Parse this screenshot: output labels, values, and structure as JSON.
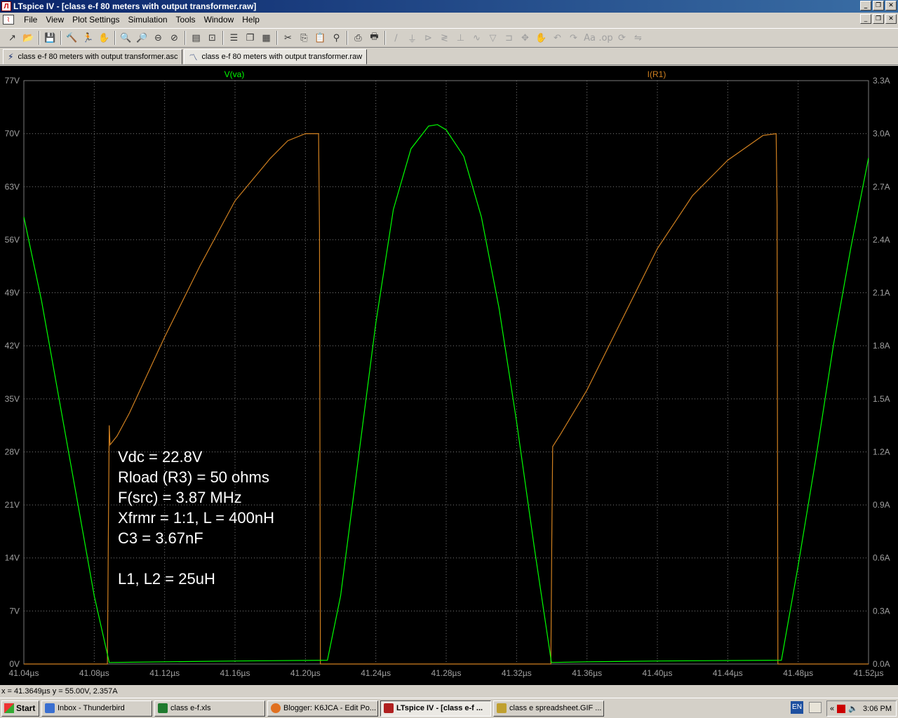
{
  "window": {
    "title": "LTspice IV - [class e-f 80 meters with output transformer.raw]",
    "app_icon": "ltspice-icon",
    "controls": [
      "_",
      "❐",
      "✕"
    ]
  },
  "menu": {
    "items": [
      "File",
      "View",
      "Plot Settings",
      "Simulation",
      "Tools",
      "Window",
      "Help"
    ],
    "mdi_controls": [
      "_",
      "❐",
      "✕"
    ]
  },
  "toolbar": {
    "icons": [
      "new-schematic-icon",
      "open-icon",
      "save-icon",
      "control-panel-icon",
      "run-icon",
      "halt-icon",
      "zoom-in-icon",
      "zoom-area-icon",
      "zoom-out-icon",
      "zoom-cancel-icon",
      "autorange-icon",
      "fit-icon",
      "tile-horizontal-icon",
      "cascade-icon",
      "tile-vertical-icon",
      "cut-icon",
      "copy-icon",
      "paste-icon",
      "find-icon",
      "print-preview-icon",
      "print-icon",
      "wire-icon",
      "ground-icon",
      "label-icon",
      "resistor-icon",
      "capacitor-icon",
      "inductor-icon",
      "diode-icon",
      "component-icon",
      "move-icon",
      "drag-icon",
      "undo-icon",
      "redo-icon",
      "text-icon",
      "spice-directive-icon",
      "rotate-icon",
      "mirror-icon"
    ]
  },
  "tabs": [
    {
      "label": "class e-f 80 meters with output transformer.asc",
      "icon": "schematic-icon"
    },
    {
      "label": "class e-f 80 meters with output transformer.raw",
      "icon": "waveform-icon"
    }
  ],
  "chart_data": {
    "type": "line",
    "traces": [
      {
        "name": "V(va)",
        "color": "#00ff00",
        "axis": "left"
      },
      {
        "name": "I(R1)",
        "color": "#d08020",
        "axis": "right"
      }
    ],
    "x_unit": "µs",
    "x_ticks": [
      "41.04µs",
      "41.08µs",
      "41.12µs",
      "41.16µs",
      "41.20µs",
      "41.24µs",
      "41.28µs",
      "41.32µs",
      "41.36µs",
      "41.40µs",
      "41.44µs",
      "41.48µs",
      "41.52µs"
    ],
    "xlim": [
      41.04,
      41.52
    ],
    "left_ticks": [
      "77V",
      "70V",
      "63V",
      "56V",
      "49V",
      "42V",
      "35V",
      "28V",
      "21V",
      "14V",
      "7V",
      "0V"
    ],
    "left_ylim": [
      0,
      77
    ],
    "right_ticks": [
      "3.3A",
      "3.0A",
      "2.7A",
      "2.4A",
      "2.1A",
      "1.8A",
      "1.5A",
      "1.2A",
      "0.9A",
      "0.6A",
      "0.3A",
      "0.0A"
    ],
    "right_ylim": [
      0,
      3.3
    ],
    "grid": true,
    "voltage": [
      [
        41.04,
        59.0
      ],
      [
        41.05,
        48.0
      ],
      [
        41.06,
        35.0
      ],
      [
        41.07,
        22.0
      ],
      [
        41.08,
        9.0
      ],
      [
        41.0885,
        0.2
      ],
      [
        41.12,
        0.3
      ],
      [
        41.16,
        0.4
      ],
      [
        41.2125,
        0.5
      ],
      [
        41.22,
        9.0
      ],
      [
        41.23,
        27.0
      ],
      [
        41.24,
        45.0
      ],
      [
        41.25,
        60.0
      ],
      [
        41.26,
        68.0
      ],
      [
        41.27,
        71.0
      ],
      [
        41.275,
        71.2
      ],
      [
        41.28,
        70.5
      ],
      [
        41.29,
        67.0
      ],
      [
        41.3,
        59.0
      ],
      [
        41.31,
        47.0
      ],
      [
        41.32,
        32.0
      ],
      [
        41.33,
        15.5
      ],
      [
        41.3398,
        0.2
      ],
      [
        41.36,
        0.3
      ],
      [
        41.4,
        0.4
      ],
      [
        41.4705,
        0.5
      ],
      [
        41.48,
        13.0
      ],
      [
        41.49,
        27.0
      ],
      [
        41.5,
        42.0
      ],
      [
        41.51,
        55.0
      ],
      [
        41.52,
        66.8
      ]
    ],
    "current": [
      [
        41.04,
        0.0
      ],
      [
        41.0875,
        0.0
      ],
      [
        41.088,
        0.7
      ],
      [
        41.0885,
        1.35
      ],
      [
        41.089,
        1.24
      ],
      [
        41.093,
        1.29
      ],
      [
        41.1,
        1.42
      ],
      [
        41.12,
        1.85
      ],
      [
        41.14,
        2.25
      ],
      [
        41.16,
        2.62
      ],
      [
        41.18,
        2.86
      ],
      [
        41.19,
        2.96
      ],
      [
        41.2,
        3.0
      ],
      [
        41.2075,
        3.0
      ],
      [
        41.208,
        2.45
      ],
      [
        41.2085,
        0.0
      ],
      [
        41.3395,
        0.0
      ],
      [
        41.34,
        0.7
      ],
      [
        41.3405,
        1.23
      ],
      [
        41.345,
        1.3
      ],
      [
        41.36,
        1.55
      ],
      [
        41.38,
        1.95
      ],
      [
        41.4,
        2.35
      ],
      [
        41.42,
        2.65
      ],
      [
        41.44,
        2.85
      ],
      [
        41.46,
        2.99
      ],
      [
        41.4675,
        3.0
      ],
      [
        41.468,
        2.6
      ],
      [
        41.4685,
        0.0
      ],
      [
        41.52,
        0.0
      ]
    ]
  },
  "annotation": {
    "lines": [
      "Vdc = 22.8V",
      "Rload (R3) = 50 ohms",
      "F(src) = 3.87 MHz",
      "Xfrmr = 1:1, L = 400nH",
      "C3 = 3.67nF",
      "",
      "L1, L2 = 25uH"
    ]
  },
  "status": {
    "cursor": "x = 41.3649µs    y = 55.00V, 2.357A"
  },
  "taskbar": {
    "start_label": "Start",
    "buttons": [
      {
        "label": "Inbox - Thunderbird",
        "color": "#3a6fd0",
        "active": false
      },
      {
        "label": "class e-f.xls",
        "color": "#1f7a2e",
        "active": false
      },
      {
        "label": "Blogger: K6JCA - Edit Po...",
        "color": "#e07020",
        "active": false
      },
      {
        "label": "LTspice IV - [class e-f ...",
        "color": "#b02020",
        "active": true
      },
      {
        "label": "class e spreadsheet.GIF ...",
        "color": "#c0a030",
        "active": false
      }
    ],
    "language": "EN",
    "clock": "3:06 PM"
  }
}
